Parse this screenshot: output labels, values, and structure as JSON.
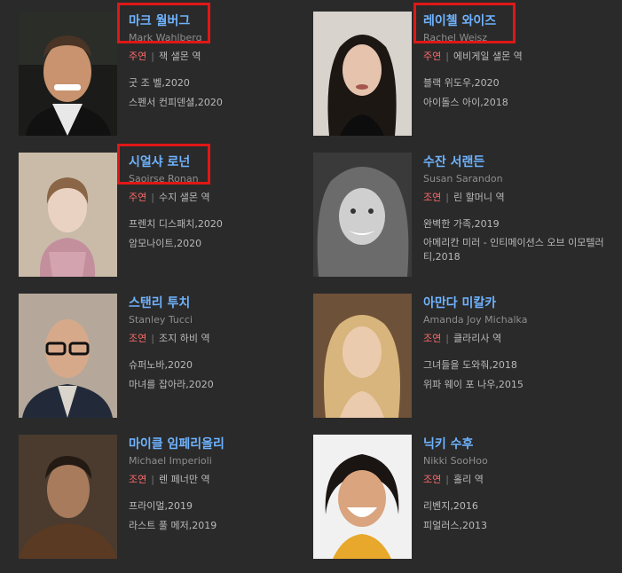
{
  "colors": {
    "background": "#2a2a2a",
    "name": "#6fb3ff",
    "role": "#ff6a6a",
    "highlight": "#e01717"
  },
  "cast": [
    {
      "name_ko": "마크 월버그",
      "name_en": "Mark Wahlberg",
      "role_type": "주연",
      "role": "잭 샐몬 역",
      "films": [
        "굿 조 벨,2020",
        "스펜서 컨피덴셜,2020"
      ]
    },
    {
      "name_ko": "레이첼 와이즈",
      "name_en": "Rachel Weisz",
      "role_type": "주연",
      "role": "에비게일 샐몬 역",
      "films": [
        "블랙 위도우,2020",
        "아이돌스 아이,2018"
      ]
    },
    {
      "name_ko": "시얼샤 로넌",
      "name_en": "Saoirse Ronan",
      "role_type": "주연",
      "role": "수지 샐몬 역",
      "films": [
        "프렌치 디스패치,2020",
        "암모나이트,2020"
      ]
    },
    {
      "name_ko": "수잔 서랜든",
      "name_en": "Susan Sarandon",
      "role_type": "조연",
      "role": "린 할머니 역",
      "films": [
        "완벽한 가족,2019",
        "아메리칸 미러 - 인티메이션스 오브 이모텔러티,2018"
      ]
    },
    {
      "name_ko": "스탠리 투치",
      "name_en": "Stanley Tucci",
      "role_type": "조연",
      "role": "조지 하비 역",
      "films": [
        "슈퍼노바,2020",
        "마녀를 잡아라,2020"
      ]
    },
    {
      "name_ko": "아만다 미칼카",
      "name_en": "Amanda Joy Michalka",
      "role_type": "조연",
      "role": "클라리사 역",
      "films": [
        "그녀들을 도와줘,2018",
        "위파 웨이 포 나우,2015"
      ]
    },
    {
      "name_ko": "마이클 임페리올리",
      "name_en": "Michael Imperioli",
      "role_type": "조연",
      "role": "렌 페너만 역",
      "films": [
        "프라이멀,2019",
        "라스트 풀 메저,2019"
      ]
    },
    {
      "name_ko": "닉키 수후",
      "name_en": "Nikki SooHoo",
      "role_type": "조연",
      "role": "홀리 역",
      "films": [
        "리벤지,2016",
        "피얼러스,2013"
      ]
    }
  ]
}
